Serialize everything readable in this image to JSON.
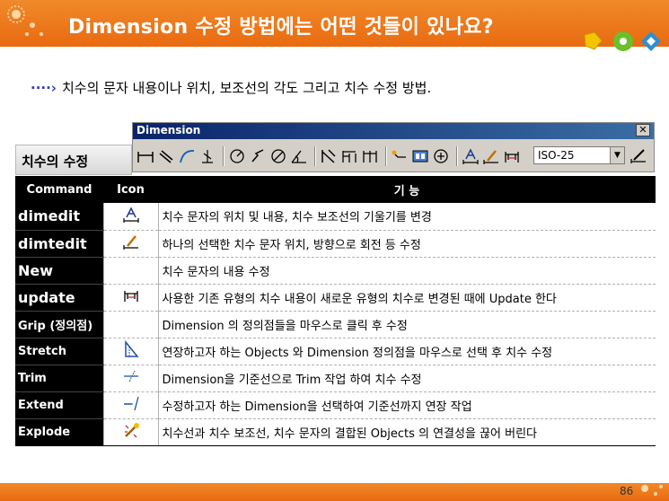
{
  "header": {
    "title_en": "Dimension",
    "title_ko": " 수정 방법에는 어떤 것들이 있나요?",
    "colors": {
      "band": "#e96a10"
    }
  },
  "subtitle": {
    "arrow": "····›",
    "text": "치수의 문자 내용이나 위치, 보조선의 각도 그리고  치수 수정 방법."
  },
  "section": {
    "label": "치수의 수정"
  },
  "toolbar": {
    "title": "Dimension",
    "close_label": "✕",
    "style_select": "ISO-25",
    "icons": [
      "linear-dim-icon",
      "aligned-dim-icon",
      "arc-length-icon",
      "ordinate-icon",
      "radius-icon",
      "jogged-icon",
      "diameter-icon",
      "angular-icon",
      "quick-dim-icon",
      "baseline-icon",
      "continue-icon",
      "leader-icon",
      "tolerance-icon",
      "center-mark-icon",
      "dimedit-icon",
      "dimtedit-icon",
      "update-icon"
    ]
  },
  "table": {
    "headers": {
      "command": "Command",
      "icon": "Icon",
      "function": "기 능"
    },
    "rows": [
      {
        "command": "dimedit",
        "icon": "dimedit-icon",
        "desc": "치수 문자의 위치 및 내용, 치수 보조선의 기울기를 변경"
      },
      {
        "command": "dimtedit",
        "icon": "dimtedit-icon",
        "desc": "하나의 선택한 치수 문자 위치, 방향으로 회전 등 수정"
      },
      {
        "command": "New",
        "icon": "",
        "desc": "치수 문자의 내용 수정"
      },
      {
        "command": "update",
        "icon": "update-icon",
        "desc": "사용한 기존 유형의 치수 내용이 새로운 유형의 치수로 변경된 때에 Update 한다"
      },
      {
        "command": "Grip (정의점)",
        "icon": "",
        "desc": "Dimension 의 정의점들을 마우스로 클릭 후 수정"
      },
      {
        "command": "Stretch",
        "icon": "stretch-icon",
        "desc": "연장하고자 하는 Objects 와 Dimension 정의점을 마우스로 선택 후 치수 수정"
      },
      {
        "command": "Trim",
        "icon": "trim-icon",
        "desc": "Dimension을 기준선으로 Trim 작업 하여 치수 수정"
      },
      {
        "command": "Extend",
        "icon": "extend-icon",
        "desc": "수정하고자 하는 Dimension을 선택하여 기준선까지 연장 작업"
      },
      {
        "command": "Explode",
        "icon": "explode-icon",
        "desc": "치수선과 치수 보조선, 치수 문자의 결합된 Objects 의 연결성을 끊어 버린다"
      }
    ]
  },
  "footer": {
    "page_number": "86"
  }
}
